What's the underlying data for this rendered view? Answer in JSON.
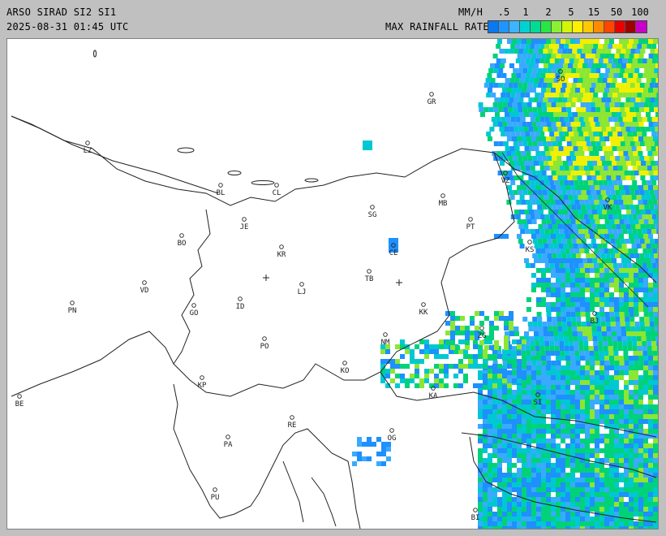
{
  "header": {
    "title": "ARSO SIRAD SI2 SI1",
    "timestamp": "2025-08-31 01:45 UTC",
    "units": "MM/H",
    "scale_label": "MAX RAINFALL RATE"
  },
  "legend": {
    "ticks": [
      ".5",
      "1",
      "2",
      "5",
      "15",
      "50",
      "100"
    ],
    "colors": [
      "#0a78f0",
      "#1e96ff",
      "#3cb4ff",
      "#00d2d2",
      "#00dc96",
      "#28e646",
      "#8cf032",
      "#d2f50a",
      "#fff000",
      "#ffc800",
      "#ff8c00",
      "#ff4600",
      "#e60000",
      "#a00000",
      "#c800c8"
    ]
  },
  "map": {
    "rain_colors": {
      "light": "#1e90ff",
      "light2": "#3aaaff",
      "cyan": "#00c8d2",
      "green": "#00d27a",
      "lime": "#8ce632",
      "yellow": "#f0f000"
    },
    "stations": [
      {
        "code": "GR"
      },
      {
        "code": "SO"
      },
      {
        "code": "LZ"
      },
      {
        "code": "BL"
      },
      {
        "code": "CL"
      },
      {
        "code": "MB"
      },
      {
        "code": "SG"
      },
      {
        "code": "JE"
      },
      {
        "code": "PT"
      },
      {
        "code": "BO"
      },
      {
        "code": "KR"
      },
      {
        "code": "CE"
      },
      {
        "code": "VD"
      },
      {
        "code": "LJ"
      },
      {
        "code": "TB"
      },
      {
        "code": "PN"
      },
      {
        "code": "GO"
      },
      {
        "code": "ID"
      },
      {
        "code": "KK"
      },
      {
        "code": "PO"
      },
      {
        "code": "NM"
      },
      {
        "code": "ZG"
      },
      {
        "code": "KO"
      },
      {
        "code": "KP"
      },
      {
        "code": "KA"
      },
      {
        "code": "BE"
      },
      {
        "code": "RE"
      },
      {
        "code": "OG"
      },
      {
        "code": "PA"
      },
      {
        "code": "PU"
      },
      {
        "code": "BI"
      },
      {
        "code": "VK"
      },
      {
        "code": "VZ"
      },
      {
        "code": "SI"
      },
      {
        "code": "KS"
      },
      {
        "code": "BJ"
      }
    ]
  }
}
